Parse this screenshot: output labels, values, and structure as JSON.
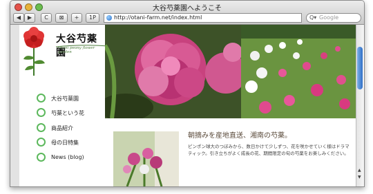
{
  "window": {
    "title": "大谷芍薬園へようこそ"
  },
  "toolbar": {
    "back": "◀",
    "forward": "▶",
    "reload": "C",
    "bookmark": "⊠",
    "add": "+",
    "home": "1P",
    "url": "http://otani-farm.net/index.html",
    "search_placeholder": "Google",
    "search_icon": "Q▾"
  },
  "site": {
    "brand": "大谷芍薬園",
    "brand_en": "Otani peony flower garden",
    "nav": [
      {
        "label": "大谷芍薬園"
      },
      {
        "label": "芍薬という花"
      },
      {
        "label": "商品紹介"
      },
      {
        "label": "母の日特集"
      },
      {
        "label": "News (blog)"
      }
    ],
    "headline": "朝摘みを産地直送、湘南の芍薬。",
    "description": "ピンポン球大のつぼみから、数日かけて少しずつ、花を咲かせていく様はドラマティック。引き立ちがよく成長の花、期間限定の旬の芍薬をお楽しみください。"
  },
  "colors": {
    "nav_ring": "#5cb85c",
    "headline": "#5a4a3a",
    "scroll_thumb": "#2f6fc6"
  }
}
